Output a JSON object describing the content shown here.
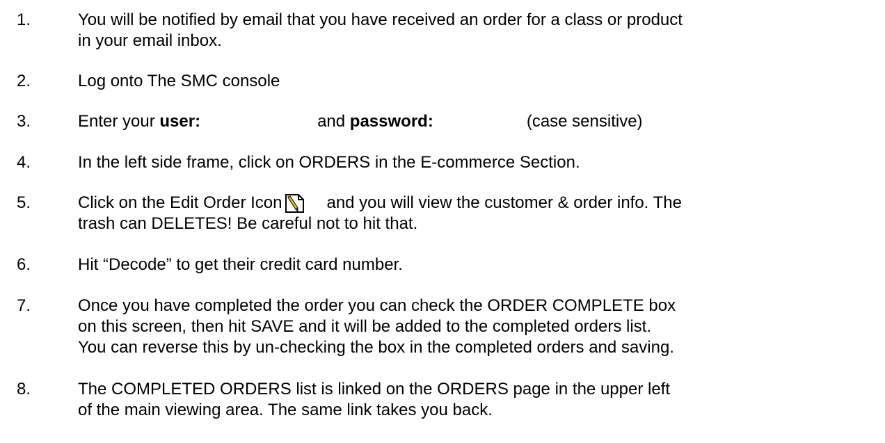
{
  "steps": [
    {
      "number": "1.",
      "lines": [
        "You will be notified by email that you have received an order for a class or product",
        "in your email inbox."
      ]
    },
    {
      "number": "2.",
      "lines": [
        "Log onto The SMC console"
      ]
    },
    {
      "number": "3.",
      "parts": {
        "enter": "Enter your ",
        "user_label": "user:",
        "and": "and ",
        "password_label": "password:",
        "case_note": "(case sensitive)"
      }
    },
    {
      "number": "4.",
      "lines": [
        "In the left side frame, click on ORDERS in the E-commerce Section."
      ]
    },
    {
      "number": "5.",
      "parts": {
        "before_icon": "Click on the Edit Order Icon",
        "after_icon": "and you will view the customer & order info.  The",
        "line2": "trash can DELETES!  Be careful not to hit that."
      },
      "icon": "edit-order-icon"
    },
    {
      "number": "6.",
      "lines": [
        "Hit “Decode” to get their credit card number."
      ]
    },
    {
      "number": "7.",
      "lines": [
        "Once you have completed the order you can check the ORDER COMPLETE box",
        "on this screen, then hit SAVE and it will be added to the completed orders list.",
        "You can reverse this by un-checking the box in the completed orders and saving."
      ]
    },
    {
      "number": "8.",
      "lines": [
        "The COMPLETED ORDERS list is linked on the ORDERS page in the upper left",
        "of the main viewing area.  The same link takes you back."
      ]
    }
  ],
  "colors": {
    "text": "#000000",
    "background": "#ffffff",
    "icon_pencil": "#e8c21a",
    "icon_tip": "#d0332b"
  }
}
